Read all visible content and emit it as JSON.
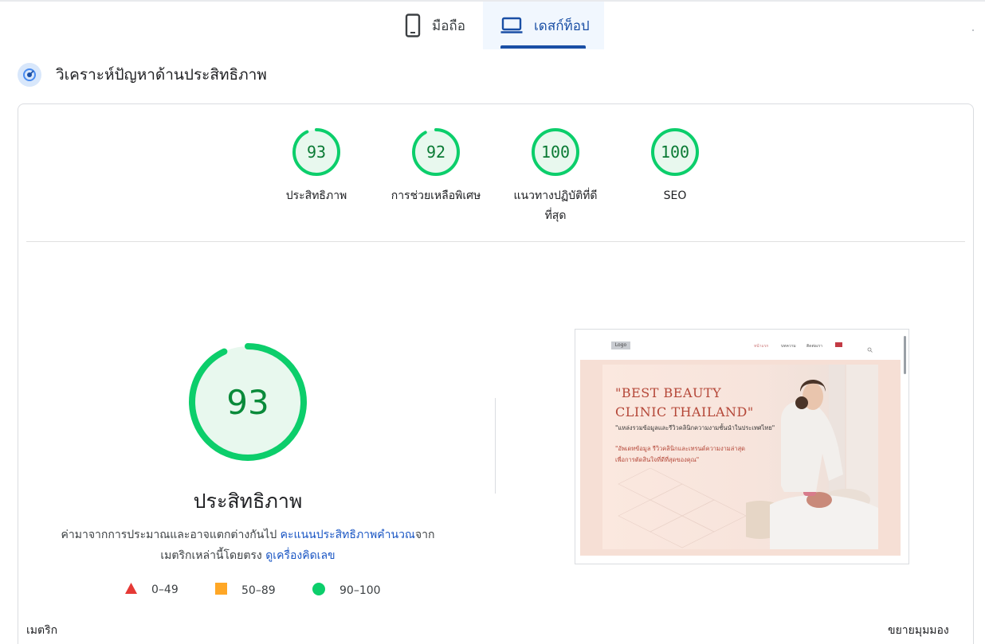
{
  "tabs": [
    {
      "label": "มือถือ",
      "icon": "smartphone-icon",
      "selected": false
    },
    {
      "label": "เดสก์ท็อป",
      "icon": "laptop-icon",
      "selected": true
    }
  ],
  "diagnose": {
    "title": "วิเคราะห์ปัญหาด้านประสิทธิภาพ",
    "icon": "speedometer-icon"
  },
  "categories": [
    {
      "score": "93",
      "label": "ประสิทธิภาพ",
      "fraction": 0.93
    },
    {
      "score": "92",
      "label": "การช่วยเหลือพิเศษ",
      "fraction": 0.92
    },
    {
      "score": "100",
      "label_line1": "แนวทางปฏิบัติที่ดี",
      "label_line2": "ที่สุด",
      "fraction": 1.0
    },
    {
      "score": "100",
      "label": "SEO",
      "fraction": 1.0
    }
  ],
  "performance": {
    "score": "93",
    "fraction": 0.93,
    "title": "ประสิทธิภาพ",
    "desc_part1": "ค่ามาจากการประมาณและอาจแตกต่างกันไป ",
    "link1": "คะแนนประสิทธิภาพคำนวณ",
    "desc_part2": "จาก",
    "desc_part3": "เมตริกเหล่านี้โดยตรง ",
    "link2": "ดูเครื่องคิดเลข"
  },
  "legend": [
    {
      "range": "0–49",
      "shape": "triangle",
      "color": "#e53935"
    },
    {
      "range": "50–89",
      "shape": "square",
      "color": "#ffa726"
    },
    {
      "range": "90–100",
      "shape": "circle",
      "color": "#0cce6b"
    }
  ],
  "colors": {
    "pass": "#0cce6b",
    "pass_text": "#0a7a34",
    "pass_fill": "#e8f8ee",
    "accent": "#1a4fa5"
  },
  "footer": {
    "metrics_label": "เมตริก",
    "expand_label": "ขยายมุมมอง"
  },
  "thumbnail": {
    "logo": "Logo",
    "nav": [
      "หน้าแรก",
      "บทความ",
      "ติดต่อเรา"
    ],
    "headline1": "\"BEST BEAUTY",
    "headline2": "CLINIC THAILAND\"",
    "subline": "\"แหล่งรวมข้อมูลและรีวิวคลินิกความงามชั้นนำในประเทศไทย\"",
    "tagline1": "\"อัพเดทข้อมูล รีวิวคลินิกและเทรนด์ความงามล่าสุด",
    "tagline2": "เพื่อการตัดสินใจที่ดีที่สุดของคุณ\""
  }
}
